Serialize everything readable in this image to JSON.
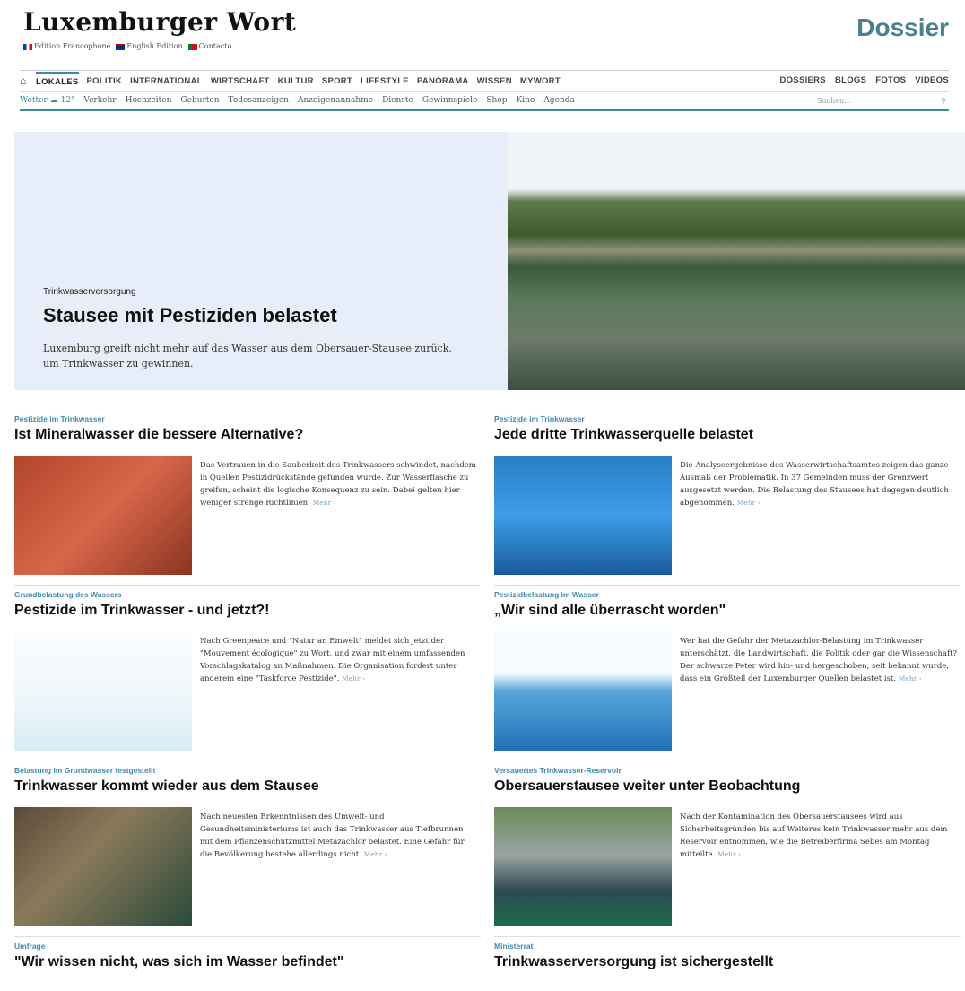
{
  "header": {
    "logo": "Luxemburger Wort",
    "editions": [
      "Edition Francophone",
      "English Edition",
      "Contacto"
    ],
    "section_title": "Dossier"
  },
  "nav_main": {
    "home_icon": "home-icon",
    "items": [
      "LOKALES",
      "POLITIK",
      "INTERNATIONAL",
      "WIRTSCHAFT",
      "KULTUR",
      "SPORT",
      "LIFESTYLE",
      "PANORAMA",
      "WISSEN",
      "MYWORT"
    ],
    "active_index": 0,
    "right_items": [
      "DOSSIERS",
      "BLOGS",
      "FOTOS",
      "VIDEOS"
    ]
  },
  "nav_sub": {
    "weather_label": "Wetter",
    "temperature": "12°",
    "items": [
      "Verkehr",
      "Hochzeiten",
      "Geburten",
      "Todesanzeigen",
      "Anzeigenannahme",
      "Dienste",
      "Gewinnspiele",
      "Shop",
      "Kino",
      "Agenda"
    ],
    "search_placeholder": "Suchen..."
  },
  "hero": {
    "kicker": "Trinkwasserversorgung",
    "title": "Stausee mit Pestiziden belastet",
    "description": "Luxemburg greift nicht mehr auf das Wasser aus dem Obersauer-Stausee zurück, um Trinkwasser zu gewinnen."
  },
  "articles": [
    {
      "kicker": "Pestizide im Trinkwasser",
      "title": "Ist Mineralwasser die bessere Alternative?",
      "text": "Das Vertrauen in die Sauberkeit des Trinkwassers schwindet, nachdem in Quellen Pestizidrückstände gefunden wurde. Zur Wasserflasche zu greifen, scheint die logische Konsequenz zu sein. Dabei gelten hier weniger strenge Richtlinien.",
      "more": "Mehr ›"
    },
    {
      "kicker": "Pestizide im Trinkwasser",
      "title": "Jede dritte Trinkwasserquelle belastet",
      "text": "Die Analyseergebnisse des Wasserwirtschaftsamtes zeigen das ganze Ausmaß der Problematik. In 37 Gemeinden muss der Grenzwert ausgesetzt werden. Die Belastung des Stausees hat dagegen deutlich abgenommen.",
      "more": "Mehr ›"
    },
    {
      "kicker": "Grundbelastung des Wassers",
      "title": "Pestizide im Trinkwasser - und jetzt?!",
      "text": "Nach Greenpeace und \"Natur an Emwelt\" meldet sich jetzt der \"Mouvement écologique\" zu Wort, und zwar mit einem umfassenden Vorschlagskatalog an Maßnahmen. Die Organisation fordert unter anderem eine \"Taskforce Pestizide\".",
      "more": "Mehr ›"
    },
    {
      "kicker": "Pestizidbelastung im Wasser",
      "title": "„Wir sind alle überrascht worden\"",
      "text": "Wer hat die Gefahr der Metazachlor-Belastung im Trinkwasser unterschätzt, die Landwirtschaft, die Politik oder gar die Wissenschaft? Der schwarze Peter wird hin- und hergeschoben, seit bekannt wurde, dass ein Großteil der Luxemburger Quellen belastet ist.",
      "more": "Mehr ›"
    },
    {
      "kicker": "Belastung im Grundwasser festgestellt",
      "title": "Trinkwasser kommt wieder aus dem Stausee",
      "text": "Nach neuesten Erkenntnissen des Umwelt- und Gesundheitsministeriums ist auch das Trinkwasser aus Tiefbrunnen mit dem Pflanzenschutzmittel Metazachlor belastet. Eine Gefahr für die Bevölkerung bestehe allerdings nicht.",
      "more": "Mehr ›"
    },
    {
      "kicker": "Versauertes Trinkwasser-Reservoir",
      "title": "Obersauerstausee weiter unter Beobachtung",
      "text": "Nach der Kontamination des Obersauerstausees wird aus Sicherheitsgründen bis auf Weiteres kein Trinkwasser mehr aus dem Reservoir entnommen, wie die Betreiberfirma Sebes am Montag mitteilte.",
      "more": "Mehr ›"
    },
    {
      "kicker": "Umfrage",
      "title": "\"Wir wissen nicht, was sich im Wasser befindet\"",
      "text": "",
      "more": ""
    },
    {
      "kicker": "Ministerrat",
      "title": "Trinkwasserversorgung ist sichergestellt",
      "text": "",
      "more": ""
    }
  ]
}
